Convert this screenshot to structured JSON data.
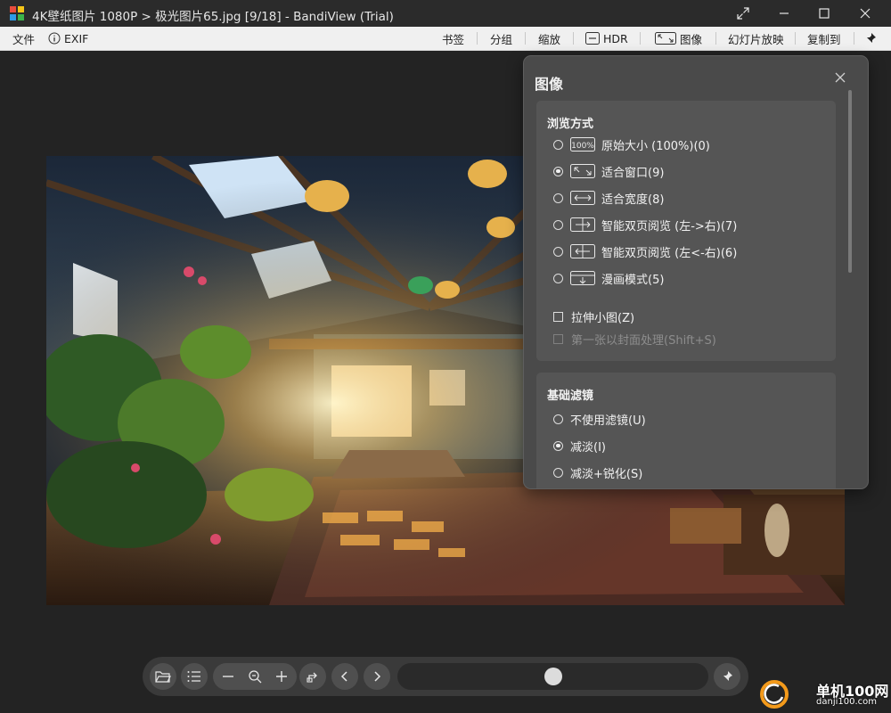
{
  "window": {
    "title": "4K壁纸图片 1080P > 极光图片65.jpg [9/18] - BandiView (Trial)",
    "icons": [
      "app-logo",
      "expand-icon",
      "minimize-icon",
      "maximize-icon",
      "close-icon"
    ]
  },
  "menu": {
    "file": "文件",
    "exif": "EXIF",
    "bookmark": "书签",
    "group": "分组",
    "zoom": "缩放",
    "hdr": "HDR",
    "image": "图像",
    "slideshow": "幻灯片放映",
    "copy_to": "复制到"
  },
  "panel": {
    "title": "图像",
    "view_mode": {
      "title": "浏览方式",
      "options": [
        {
          "label": "原始大小 (100%)(0)",
          "icon": "original-size-icon",
          "selected": false
        },
        {
          "label": "适合窗口(9)",
          "icon": "fit-window-icon",
          "selected": true
        },
        {
          "label": "适合宽度(8)",
          "icon": "fit-width-icon",
          "selected": false
        },
        {
          "label": "智能双页阅览 (左->右)(7)",
          "icon": "dual-page-ltr-icon",
          "selected": false
        },
        {
          "label": "智能双页阅览 (左<-右)(6)",
          "icon": "dual-page-rtl-icon",
          "selected": false
        },
        {
          "label": "漫画模式(5)",
          "icon": "comic-mode-icon",
          "selected": false
        }
      ],
      "stretch_small": "拉伸小图(Z)",
      "cover_first": "第一张以封面处理(Shift+S)"
    },
    "filter": {
      "title": "基础滤镜",
      "options": [
        {
          "label": "不使用滤镜(U)",
          "selected": false
        },
        {
          "label": "减淡(I)",
          "selected": true
        },
        {
          "label": "减淡+锐化(S)",
          "selected": false
        }
      ]
    }
  },
  "toolbar": {
    "buttons": [
      "open-folder-icon",
      "list-icon",
      "zoom-out-icon",
      "zoom-fit-icon",
      "zoom-in-icon",
      "rotate-icon",
      "previous-icon",
      "next-icon",
      "pin-icon"
    ],
    "progress_fraction": 0.5
  },
  "watermark": {
    "text": "单机100网",
    "url": "danji100.com"
  },
  "colors": {
    "panel_bg": "#4a4a4a",
    "section_bg": "#555555",
    "menubar_bg": "#f0f0f0",
    "titlebar_bg": "#2b2b2b"
  }
}
